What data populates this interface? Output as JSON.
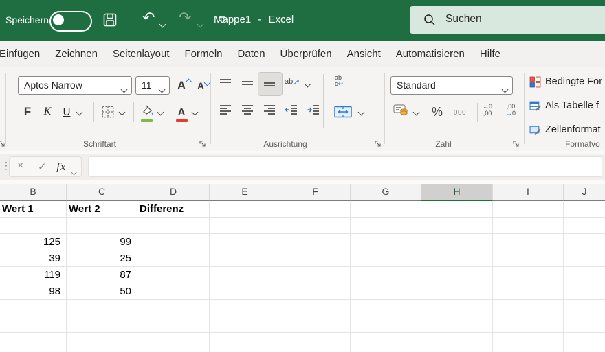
{
  "titlebar": {
    "save_label": "Speichern",
    "autosave_state": "off",
    "undo_icon": "undo-arrow",
    "redo_icon": "redo-arrow",
    "save_icon": "floppy-disk",
    "title": "Mappe1 - Excel",
    "search_placeholder": "Suchen"
  },
  "colors": {
    "brand_green": "#1E6E42",
    "selected_header_green": "#1A7340",
    "fill_color_green": "#7DBB42",
    "font_color_red": "#E03C31",
    "accent_blue": "#2B7CD3"
  },
  "tabs": [
    {
      "label": "Einfügen"
    },
    {
      "label": "Zeichnen"
    },
    {
      "label": "Seitenlayout"
    },
    {
      "label": "Formeln"
    },
    {
      "label": "Daten"
    },
    {
      "label": "Überprüfen"
    },
    {
      "label": "Ansicht"
    },
    {
      "label": "Automatisieren"
    },
    {
      "label": "Hilfe"
    }
  ],
  "ribbon": {
    "font": {
      "group_label": "Schriftart",
      "name": "Aptos Narrow",
      "size": "11",
      "grow": "A",
      "shrink": "A",
      "bold": "F",
      "italic": "K",
      "underline": "U"
    },
    "alignment": {
      "group_label": "Ausrichtung",
      "orient_text": "ab",
      "orient_arrow": "↗",
      "wrap_top": "ab",
      "wrap_bottom": "c",
      "wrap_arrow": "↩"
    },
    "number": {
      "group_label": "Zahl",
      "format": "Standard",
      "percent": "%",
      "thousands": "000",
      "add_decimal": {
        "top": "←0",
        "bottom": ",00"
      },
      "remove_decimal": {
        "top": ",00",
        "bottom": "→0"
      }
    },
    "styles": {
      "group_label": "Formatvo",
      "items": [
        "Bedingte For",
        "Als Tabelle f",
        "Zellenformat"
      ]
    }
  },
  "formula_bar": {
    "cancel": "×",
    "enter": "✓",
    "fx_label": "fx",
    "value": ""
  },
  "sheet": {
    "columns": [
      {
        "letter": "B"
      },
      {
        "letter": "C"
      },
      {
        "letter": "D"
      },
      {
        "letter": "E"
      },
      {
        "letter": "F"
      },
      {
        "letter": "G"
      },
      {
        "letter": "H",
        "selected": true
      },
      {
        "letter": "I"
      },
      {
        "letter": "J"
      }
    ],
    "rows": [
      {
        "cells": [
          {
            "col": "B",
            "text": "Wert 1",
            "bold": true
          },
          {
            "col": "C",
            "text": "Wert 2",
            "bold": true
          },
          {
            "col": "D",
            "text": "Differenz",
            "bold": true
          }
        ]
      },
      {
        "cells": []
      },
      {
        "cells": [
          {
            "col": "B",
            "text": "125",
            "num": true
          },
          {
            "col": "C",
            "text": "99",
            "num": true
          }
        ]
      },
      {
        "cells": [
          {
            "col": "B",
            "text": "39",
            "num": true
          },
          {
            "col": "C",
            "text": "25",
            "num": true
          }
        ]
      },
      {
        "cells": [
          {
            "col": "B",
            "text": "119",
            "num": true
          },
          {
            "col": "C",
            "text": "87",
            "num": true
          }
        ]
      },
      {
        "cells": [
          {
            "col": "B",
            "text": "98",
            "num": true
          },
          {
            "col": "C",
            "text": "50",
            "num": true
          }
        ]
      },
      {
        "cells": []
      },
      {
        "cells": []
      },
      {
        "cells": []
      }
    ]
  }
}
